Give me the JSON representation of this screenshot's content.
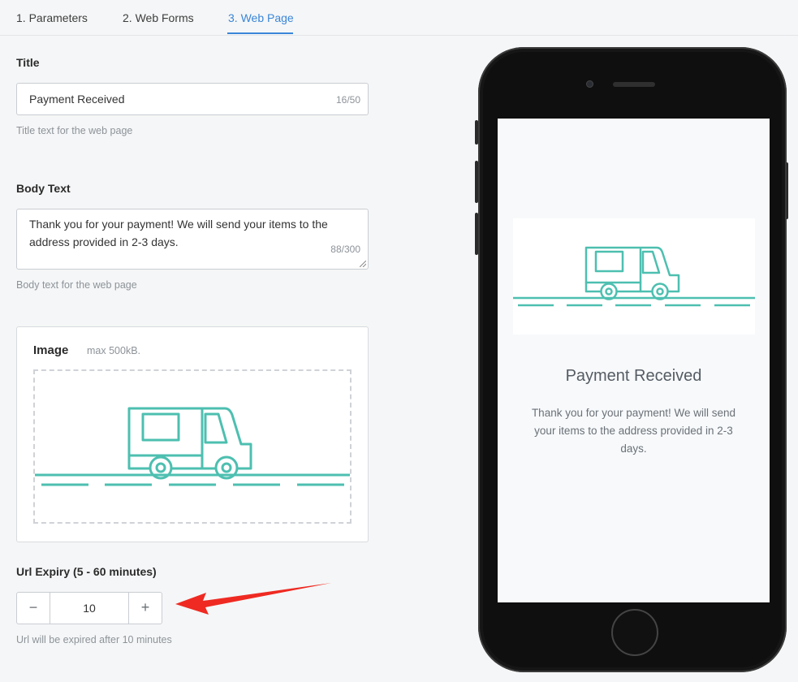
{
  "tabs": [
    {
      "label": "1. Parameters"
    },
    {
      "label": "2. Web Forms"
    },
    {
      "label": "3. Web Page"
    }
  ],
  "title_field": {
    "label": "Title",
    "value": "Payment Received",
    "counter": "16/50",
    "help": "Title text for the web page"
  },
  "body_field": {
    "label": "Body Text",
    "value": "Thank you for your payment! We will send your items to the address provided in 2-3 days.",
    "counter": "88/300",
    "help": "Body text for the web page"
  },
  "image_field": {
    "label": "Image",
    "max": "max 500kB."
  },
  "url_expiry": {
    "label": "Url Expiry (5 - 60 minutes)",
    "value": "10",
    "minus": "−",
    "plus": "+",
    "help": "Url will be expired after 10 minutes"
  },
  "preview": {
    "title": "Payment Received",
    "body": "Thank you for your payment! We will send your items to the address provided in 2-3 days."
  },
  "colors": {
    "accent": "#3a86d8",
    "illustration": "#4dbfb0",
    "annotation_arrow": "#ee2a22"
  }
}
